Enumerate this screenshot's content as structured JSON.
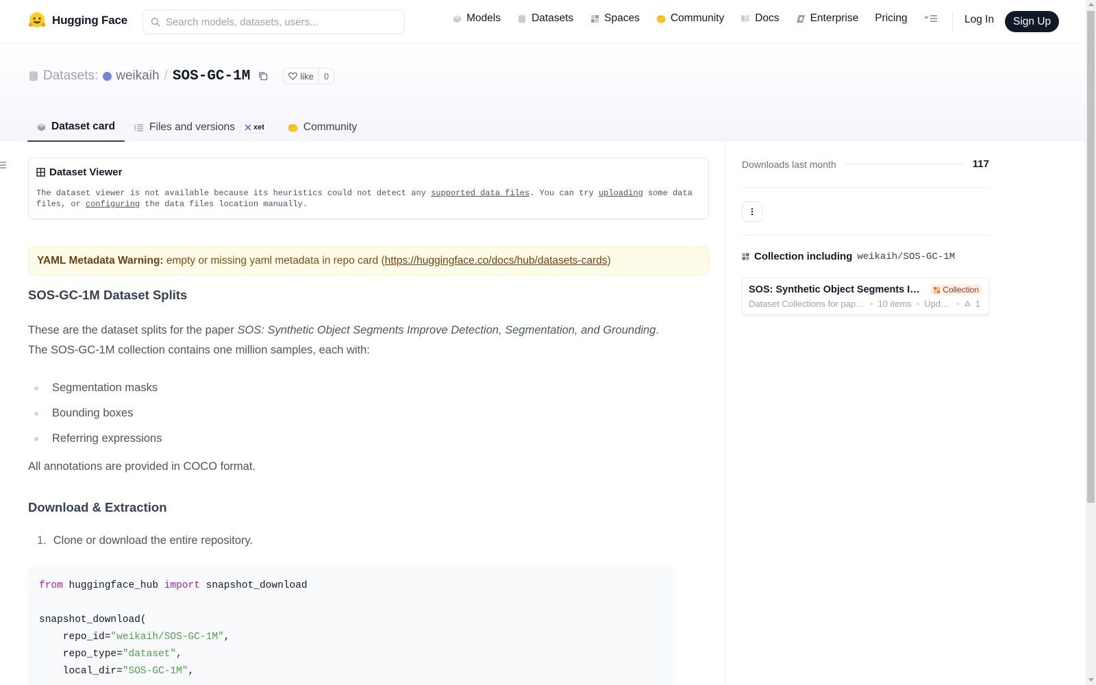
{
  "header": {
    "brand": "Hugging Face",
    "search_placeholder": "Search models, datasets, users...",
    "nav": [
      {
        "label": "Models",
        "icon": "models-icon"
      },
      {
        "label": "Datasets",
        "icon": "datasets-icon"
      },
      {
        "label": "Spaces",
        "icon": "spaces-icon"
      },
      {
        "label": "Community",
        "icon": "community-icon"
      },
      {
        "label": "Docs",
        "icon": "docs-icon"
      },
      {
        "label": "Enterprise",
        "icon": "enterprise-icon"
      },
      {
        "label": "Pricing",
        "icon": ""
      }
    ],
    "login": "Log In",
    "signup": "Sign Up"
  },
  "repo": {
    "kind": "Datasets:",
    "owner": "weikaih",
    "name": "SOS-GC-1M",
    "like_label": "like",
    "like_count": "0"
  },
  "tabs": [
    {
      "label": "Dataset card",
      "active": true
    },
    {
      "label": "Files and versions",
      "badge": "xet"
    },
    {
      "label": "Community"
    }
  ],
  "viewer": {
    "title": "Dataset Viewer",
    "msg_1": "The dataset viewer is not available because its heuristics could not detect any ",
    "link_1": "supported data files",
    "msg_2": ". You can try ",
    "link_2": "uploading",
    "msg_3": " some data files, or ",
    "link_3": "configuring",
    "msg_4": " the data files location manually."
  },
  "yaml_warning": {
    "label": "YAML Metadata Warning:",
    "text": " empty or missing yaml metadata in repo card (",
    "link": "https://huggingface.co/docs/hub/datasets-cards",
    "close": ")"
  },
  "article": {
    "h2": "SOS-GC-1M Dataset Splits",
    "intro_1": "These are the dataset splits for the paper ",
    "intro_italic": "SOS: Synthetic Object Segments Improve Detection, Segmentation, and Grounding",
    "intro_2": ". The SOS-GC-1M collection contains one million samples, each with:",
    "bullets": [
      "Segmentation masks",
      "Bounding boxes",
      "Referring expressions"
    ],
    "coco_note": "All annotations are provided in COCO format.",
    "h3": "Download & Extraction",
    "step_num": "1.",
    "step_text": "Clone or download the entire repository.",
    "code": {
      "kw_from": "from",
      "mod": " huggingface_hub ",
      "kw_import": "import",
      "fn": " snapshot_download",
      "call": "snapshot_download(",
      "arg1": "    repo_id=",
      "val1": "\"weikaih/SOS-GC-1M\"",
      "arg2": "    repo_type=",
      "val2": "\"dataset\"",
      "arg3": "    local_dir=",
      "val3": "\"SOS-GC-1M\"",
      "comma": ","
    }
  },
  "sidebar": {
    "downloads_label": "Downloads last month",
    "downloads_value": "117",
    "collection_heading": "Collection including",
    "collection_repo": "weikaih/SOS-GC-1M",
    "card": {
      "name": "SOS: Synthetic Object Segments Improve Detection, Segmentation, and Grounding",
      "badge": "Collection",
      "desc": "Dataset Collections for paper SOS",
      "items": "10 items",
      "updated": "Updated",
      "upvotes": "1"
    }
  },
  "colors": {
    "accent_dark": "#111827",
    "warning_bg": "#fefce8",
    "warning_text": "#854d0e",
    "code_keyword": "#a626a4",
    "code_string": "#50a14f"
  }
}
